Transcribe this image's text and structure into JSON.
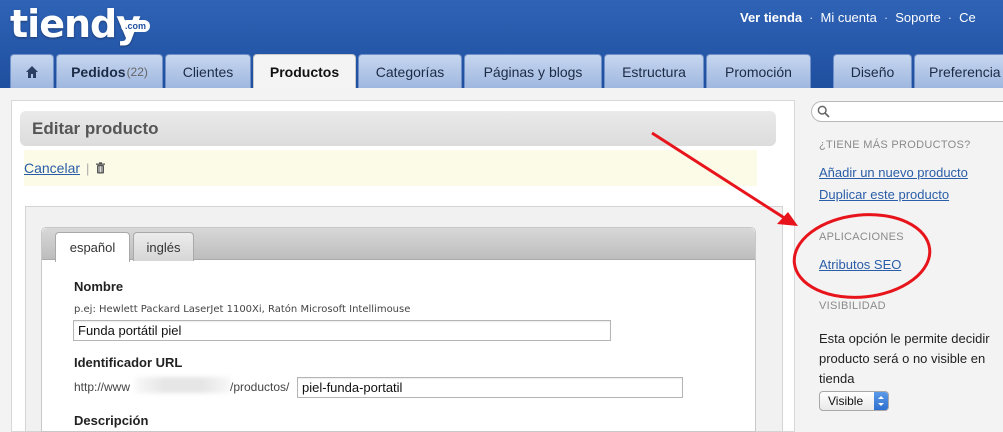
{
  "header": {
    "logo": "tiendy",
    "logo_badge": ".com",
    "toplinks": [
      "Ver tienda",
      "Mi cuenta",
      "Soporte",
      "Ce"
    ]
  },
  "tabs": [
    {
      "label": "",
      "icon": "home-icon"
    },
    {
      "label": "Pedidos",
      "badge": "(22)"
    },
    {
      "label": "Clientes"
    },
    {
      "label": "Productos",
      "active": true
    },
    {
      "label": "Categorías"
    },
    {
      "label": "Páginas y blogs"
    },
    {
      "label": "Estructura"
    },
    {
      "label": "Promoción"
    },
    {
      "label": "Diseño"
    },
    {
      "label": "Preferencia"
    }
  ],
  "main": {
    "title": "Editar producto",
    "cancel_label": "Cancelar",
    "pipe": "|",
    "lang_tabs": [
      "español",
      "inglés"
    ],
    "name_label": "Nombre",
    "name_hint": "p.ej: Hewlett Packard LaserJet 1100Xi, Ratón Microsoft Intellimouse",
    "name_value": "Funda portátil piel",
    "url_label": "Identificador URL",
    "url_prefix_start": "http://www",
    "url_prefix_end": "/productos/",
    "url_value": "piel-funda-portatil",
    "desc_label": "Descripción"
  },
  "sidebar": {
    "more_heading": "¿TIENE MÁS PRODUCTOS?",
    "add_link": "Añadir un nuevo producto",
    "dup_link": "Duplicar este producto",
    "apps_heading": "APLICACIONES",
    "seo_link": "Atributos SEO",
    "vis_heading": "VISIBILIDAD",
    "vis_text": "Esta opción le permite decidir producto será o no visible en tienda",
    "vis_select": "Visible"
  },
  "colors": {
    "header_blue": "#2f63b6",
    "link_blue": "#2a5da8",
    "annotation_red": "#e8141b"
  }
}
